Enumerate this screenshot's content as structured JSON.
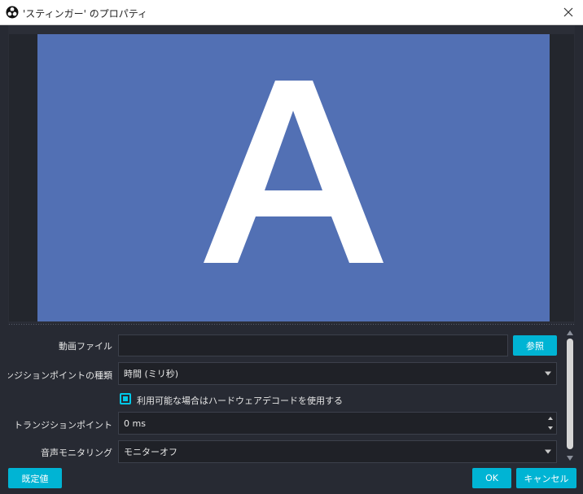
{
  "window": {
    "title": "'スティンガー' のプロパティ"
  },
  "preview": {
    "letter": "A",
    "canvas_color": "#5270b4"
  },
  "form": {
    "video_file": {
      "label": "動画ファイル",
      "value": "",
      "browse_label": "参照"
    },
    "transition_point_type": {
      "label": "トランジションポイントの種類",
      "selected": "時間 (ミリ秒)"
    },
    "hw_decode": {
      "label": "利用可能な場合はハードウェアデコードを使用する",
      "checked": true
    },
    "transition_point": {
      "label": "トランジションポイント",
      "value": "0 ms"
    },
    "audio_monitoring": {
      "label": "音声モニタリング",
      "selected": "モニターオフ"
    }
  },
  "footer": {
    "defaults_label": "既定値",
    "ok_label": "OK",
    "cancel_label": "キャンセル"
  },
  "colors": {
    "accent": "#00b4d4",
    "background": "#272a33",
    "field": "#1f2127"
  }
}
